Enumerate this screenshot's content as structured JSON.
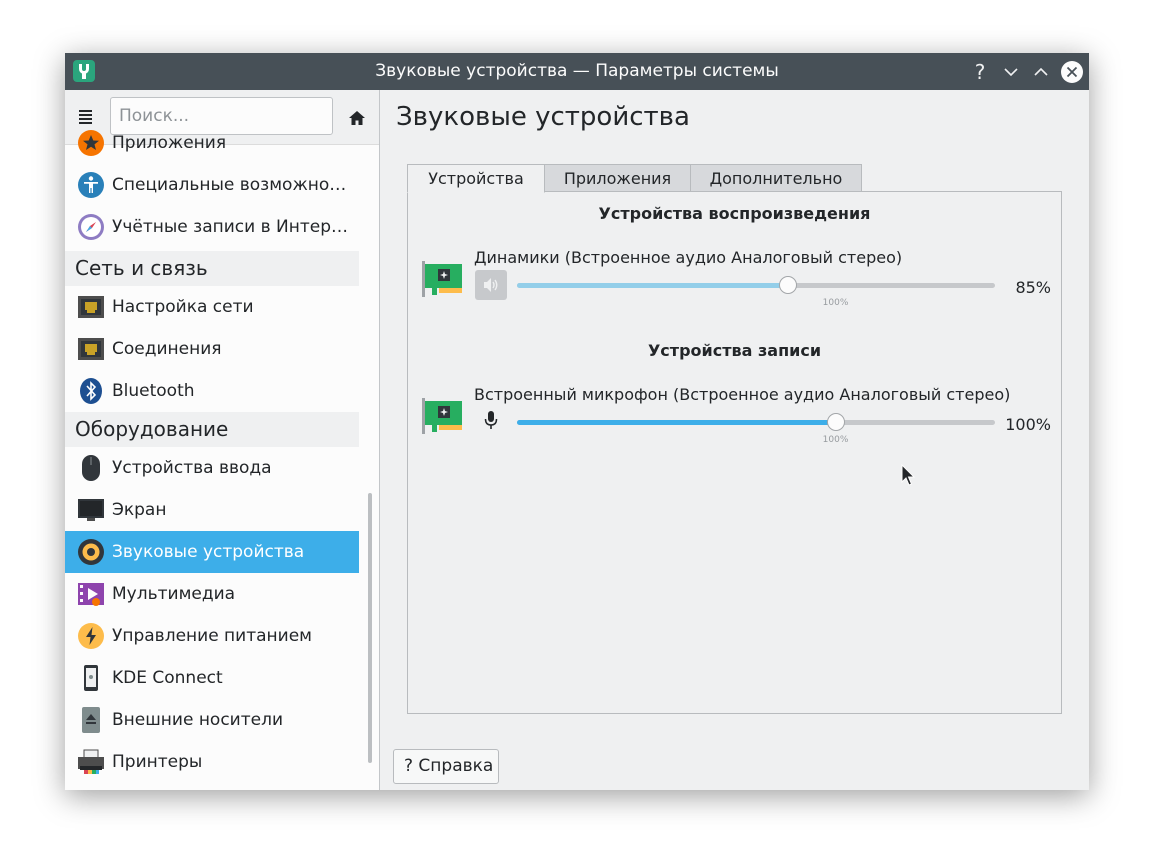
{
  "window": {
    "title": "Звуковые устройства — Параметры системы",
    "help_glyph": "?"
  },
  "sidebar": {
    "search_placeholder": "Поиск...",
    "items": [
      {
        "label": "Приложения",
        "icon": "star-icon"
      },
      {
        "label": "Специальные возможности",
        "icon": "accessibility-icon"
      },
      {
        "label": "Учётные записи в Интернете",
        "icon": "online-accounts-icon"
      },
      {
        "category": "Сеть и связь"
      },
      {
        "label": "Настройка сети",
        "icon": "network-icon"
      },
      {
        "label": "Соединения",
        "icon": "connections-icon"
      },
      {
        "label": "Bluetooth",
        "icon": "bluetooth-icon"
      },
      {
        "category": "Оборудование"
      },
      {
        "label": "Устройства ввода",
        "icon": "mouse-icon"
      },
      {
        "label": "Экран",
        "icon": "display-icon"
      },
      {
        "label": "Звуковые устройства",
        "icon": "speaker-icon",
        "active": true
      },
      {
        "label": "Мультимедиа",
        "icon": "multimedia-icon"
      },
      {
        "label": "Управление питанием",
        "icon": "power-icon"
      },
      {
        "label": "KDE Connect",
        "icon": "phone-icon"
      },
      {
        "label": "Внешние носители",
        "icon": "eject-icon"
      },
      {
        "label": "Принтеры",
        "icon": "printer-icon"
      }
    ]
  },
  "main": {
    "title": "Звуковые устройства",
    "tabs": [
      {
        "label": "Устройства",
        "active": true
      },
      {
        "label": "Приложения"
      },
      {
        "label": "Дополнительно"
      }
    ],
    "playback": {
      "section_title": "Устройства воспроизведения",
      "device_name": "Динамики (Встроенное аудио Аналоговый стерео)",
      "volume_percent": 85,
      "volume_label": "85%",
      "tick_label": "100%"
    },
    "capture": {
      "section_title": "Устройства записи",
      "device_name": "Встроенный микрофон (Встроенное аудио Аналоговый стерео)",
      "volume_percent": 100,
      "volume_label": "100%",
      "tick_label": "100%"
    },
    "help_button": "? Справка"
  },
  "colors": {
    "accent": "#3daee9",
    "titlebar": "#475057",
    "playback_fill": "#93cee9",
    "capture_fill": "#3daee9"
  }
}
